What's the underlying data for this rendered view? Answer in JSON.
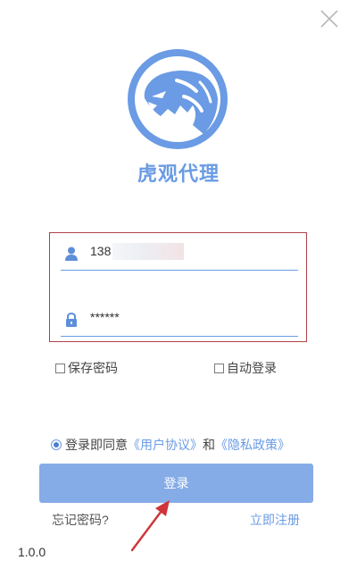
{
  "window": {
    "close_icon": "close-icon"
  },
  "app": {
    "title": "虎观代理",
    "logo_icon": "tiger-head-icon",
    "brand_color": "#6a9be4"
  },
  "form": {
    "username": {
      "icon": "user-icon",
      "value": "138"
    },
    "password": {
      "icon": "lock-icon",
      "value": "******"
    }
  },
  "options": {
    "save_password": {
      "label": "保存密码",
      "checked": false
    },
    "auto_login": {
      "label": "自动登录",
      "checked": false
    }
  },
  "agreement": {
    "checked": true,
    "prefix": "登录即同意",
    "user_agreement": "《用户协议》",
    "conjunction": "和",
    "privacy_policy": "《隐私政策》"
  },
  "actions": {
    "login_label": "登录",
    "forgot_password": "忘记密码?",
    "register": "立即注册"
  },
  "version": "1.0.0",
  "highlight": {
    "box_color": "#b1424a",
    "arrow_color": "#d0343a"
  }
}
